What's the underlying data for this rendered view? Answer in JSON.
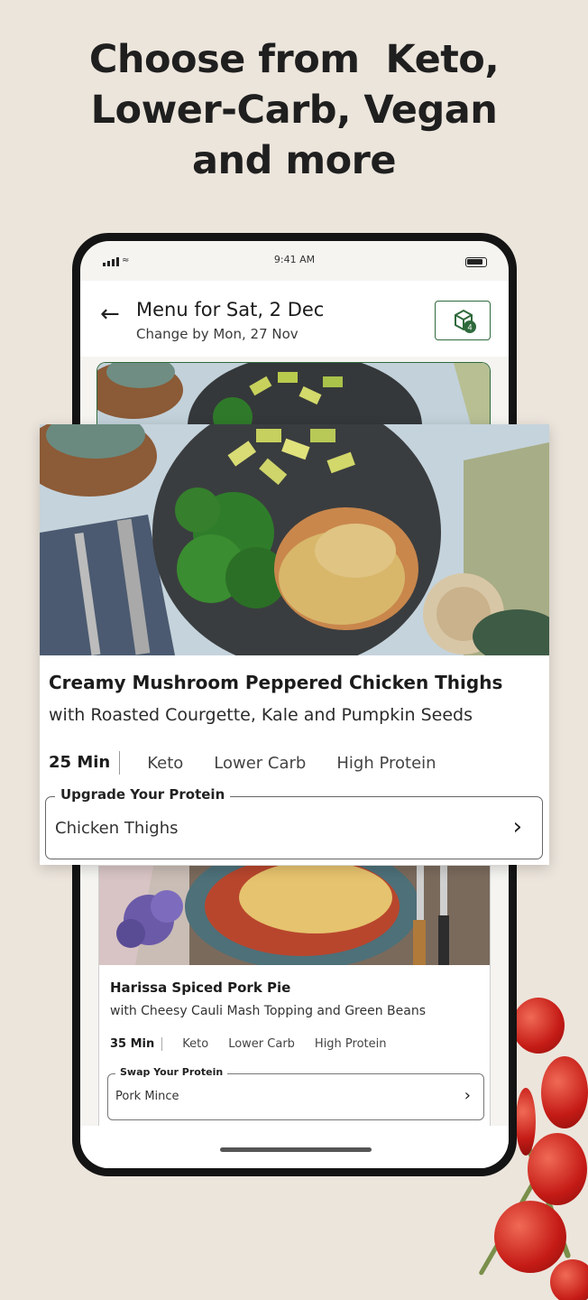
{
  "headline": {
    "line1": "Choose from  Keto,",
    "line2": "Lower-Carb, Vegan",
    "line3": "and more"
  },
  "status": {
    "time": "9:41 AM"
  },
  "header": {
    "title": "Menu for Sat, 2 Dec",
    "subtitle": "Change by Mon, 27 Nov",
    "box_count": "4"
  },
  "featured": {
    "title": "Creamy Mushroom Peppered Chicken Thighs",
    "subtitle": "with Roasted Courgette, Kale and Pumpkin Seeds",
    "time": "25 Min",
    "tags": [
      "Keto",
      "Lower Carb",
      "High Protein"
    ],
    "field_label": "Upgrade Your Protein",
    "field_value": "Chicken Thighs"
  },
  "second": {
    "title": "Harissa Spiced Pork Pie",
    "subtitle": "with Cheesy Cauli Mash Topping and Green Beans",
    "time": "35 Min",
    "tags": [
      "Keto",
      "Lower Carb",
      "High Protein"
    ],
    "field_label": "Swap Your Protein",
    "field_value": "Pork Mince"
  },
  "colors": {
    "accent": "#2f6a3c",
    "background": "#ece5dc"
  }
}
